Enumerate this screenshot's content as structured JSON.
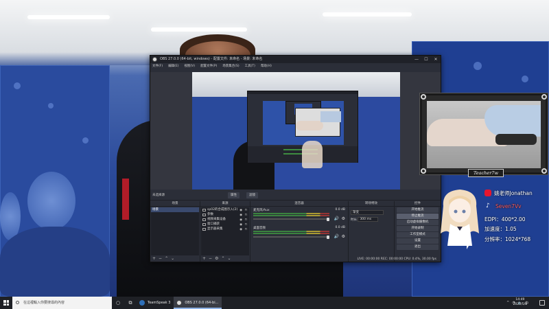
{
  "obs": {
    "title": "OBS 27.0.0 (64-bit, windows) - 配置文件: 未命名 - 场景: 未命名",
    "menu": [
      "文件(F)",
      "编辑(E)",
      "视图(V)",
      "配置文件(P)",
      "场景集合(S)",
      "工具(T)",
      "帮助(H)"
    ],
    "scene_bar_label": "未选择源",
    "props_label": "属性",
    "filters_label": "滤镜",
    "docks": {
      "scenes": {
        "header": "场景",
        "items": [
          "场景"
        ]
      },
      "sources": {
        "header": "来源",
        "items": [
          "sp02的合成图示入(2)",
          "参数",
          "视频采集设备",
          "窗口捕获",
          "显示器采集"
        ]
      },
      "mixer": {
        "header": "混音器",
        "channels": [
          {
            "name": "麦克风/Aux",
            "db": "0.0 dB"
          },
          {
            "name": "桌面音频",
            "db": "0.0 dB"
          }
        ]
      },
      "transitions": {
        "header": "转场特效",
        "type": "渐变",
        "duration_label": "时长",
        "duration": "300 ms"
      },
      "controls": {
        "header": "控件",
        "buttons": [
          "开始推流",
          "停止推流",
          "启动虚拟摄像机",
          "开始录制",
          "工作室模式",
          "设置",
          "退出"
        ],
        "active_index": 1
      }
    },
    "status": "LIVE: 00:00:00    REC: 00:00:00    CPU: 0.4%, 30.00 fps"
  },
  "overlay": {
    "name_plate": "Teacher7w",
    "weibo": "姚老师Jonathan",
    "tiktok": "Seven7Vv",
    "stats": [
      "EDPI：400*2.00",
      "加速度：1.05",
      "分辨率：1024*768"
    ]
  },
  "taskbar": {
    "search_placeholder": "在這裡輸入你要搜尋的內容",
    "apps": [
      {
        "label": "TeamSpeak 3",
        "active": false
      },
      {
        "label": "OBS 27.0.0 (64-bi...",
        "active": true
      }
    ],
    "time": "14:49",
    "date": "2022/5/8"
  },
  "colors": {
    "obs_bg": "#2b2e38",
    "taskbar": "#1e2025",
    "weibo_red": "#e6162d",
    "accent_blue": "#2b4a9a"
  }
}
